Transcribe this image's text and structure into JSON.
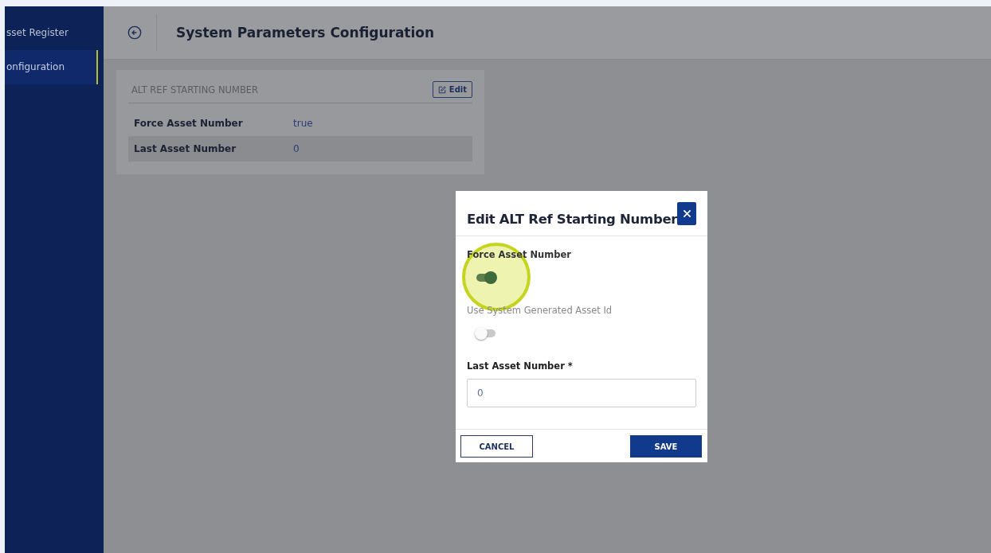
{
  "sidebar": {
    "items": [
      {
        "label": "sset Register",
        "selected": false
      },
      {
        "label": "onfiguration",
        "selected": true
      }
    ]
  },
  "header": {
    "title": "System Parameters Configuration"
  },
  "card": {
    "title": "ALT REF STARTING NUMBER",
    "edit_button": "Edit",
    "rows": [
      {
        "label": "Force Asset Number",
        "value": "true"
      },
      {
        "label": "Last Asset Number",
        "value": "0"
      }
    ]
  },
  "dialog": {
    "title": "Edit ALT Ref Starting Number",
    "switches": [
      {
        "label": "Force Asset Number",
        "on": true
      },
      {
        "label": "Use System Generated Asset Id",
        "on": false
      }
    ],
    "field": {
      "label": "Last Asset Number *",
      "value": "0"
    },
    "buttons": {
      "cancel": "CANCEL",
      "save": "SAVE"
    }
  }
}
